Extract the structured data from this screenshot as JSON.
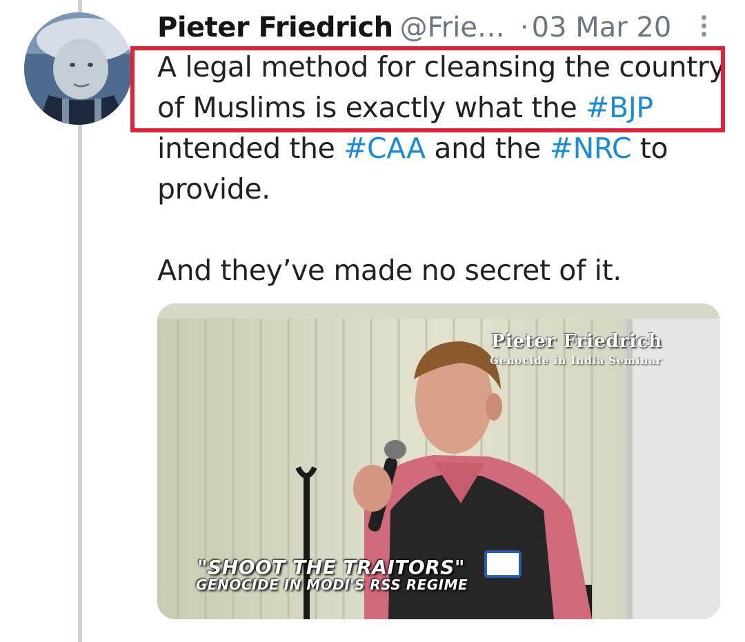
{
  "tweet": {
    "author_name": "Pieter Friedrich",
    "handle": "@Frie…",
    "separator": "·",
    "date": "03 Mar 20",
    "more_icon": "vertical-ellipsis-icon",
    "body": {
      "line1": "A legal method for cleansing the country",
      "line2_text": "of Muslims is exactly what the ",
      "line2_hashtag": "#BJP",
      "line3_text1": "intended the ",
      "line3_hashtag1": "#CAA",
      "line3_text2": " and the ",
      "line3_hashtag2": "#NRC",
      "line3_text3": " to",
      "line4": "provide.",
      "line5": "And they’ve made no secret of it."
    },
    "media": {
      "overlay_title": "Pieter Friedrich",
      "overlay_subtitle": "Genocide in India Seminar",
      "caption_main": "\"SHOOT THE TRAITORS\"",
      "caption_sub": "GENOCIDE IN MODI'S RSS REGIME"
    }
  },
  "colors": {
    "hashtag": "#1c8bd4",
    "highlight_border": "#e2223b",
    "thread_line": "#c9d3d9",
    "meta_text": "#6b7780"
  }
}
